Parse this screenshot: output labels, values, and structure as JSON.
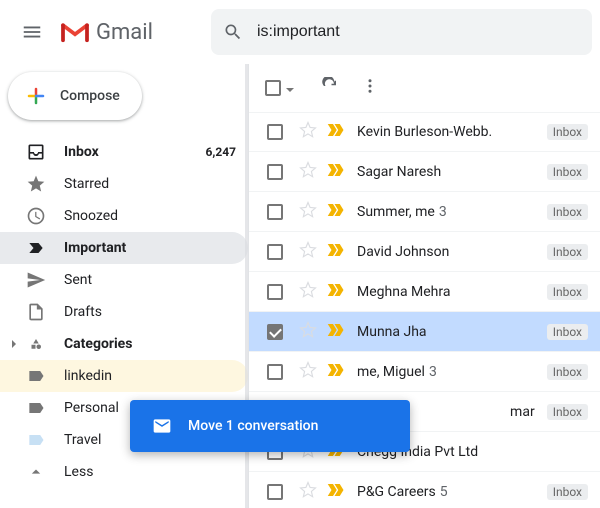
{
  "header": {
    "logo_text": "Gmail",
    "search_value": "is:important"
  },
  "compose": {
    "label": "Compose"
  },
  "sidebar": {
    "items": [
      {
        "label": "Inbox",
        "count": "6,247"
      },
      {
        "label": "Starred"
      },
      {
        "label": "Snoozed"
      },
      {
        "label": "Important"
      },
      {
        "label": "Sent"
      },
      {
        "label": "Drafts"
      }
    ],
    "categories_label": "Categories",
    "categories": [
      {
        "label": "linkedin"
      },
      {
        "label": "Personal"
      },
      {
        "label": "Travel"
      }
    ],
    "less_label": "Less"
  },
  "emails": [
    {
      "sender": "Kevin Burleson-Webb.",
      "badge": "Inbox"
    },
    {
      "sender": "Sagar Naresh",
      "badge": "Inbox"
    },
    {
      "sender": "Summer, me",
      "count": "3",
      "badge": "Inbox"
    },
    {
      "sender": "David Johnson",
      "badge": "Inbox"
    },
    {
      "sender": "Meghna Mehra",
      "badge": "Inbox"
    },
    {
      "sender": "Munna Jha",
      "badge": "Inbox"
    },
    {
      "sender": "me, Miguel",
      "count": "3",
      "badge": "Inbox"
    },
    {
      "sender": "mar",
      "badge": "Inbox"
    },
    {
      "sender": "Chegg India Pvt Ltd",
      "badge": ""
    },
    {
      "sender": "P&G Careers",
      "count": "5",
      "badge": "Inbox"
    }
  ],
  "toast": {
    "text": "Move 1 conversation"
  }
}
